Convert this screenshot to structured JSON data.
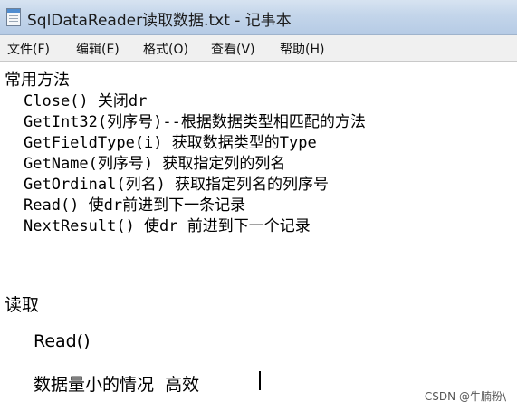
{
  "window": {
    "title": "SqlDataReader读取数据.txt - 记事本"
  },
  "menu": {
    "file": "文件(F)",
    "edit": "编辑(E)",
    "format": "格式(O)",
    "view": "查看(V)",
    "help": "帮助(H)"
  },
  "content": {
    "line1": "常用方法",
    "line2": "Close() 关闭dr",
    "line3": "GetInt32(列序号)--根据数据类型相匹配的方法",
    "line4": "GetFieldType(i) 获取数据类型的Type",
    "line5": "GetName(列序号) 获取指定列的列名",
    "line6": "GetOrdinal(列名) 获取指定列名的列序号",
    "line7": "Read() 使dr前进到下一条记录",
    "line8": "NextResult() 使dr 前进到下一个记录",
    "line9": "读取",
    "line10": "Read()",
    "line11": "数据量小的情况  高效"
  },
  "watermark": "CSDN @牛腩粉\\"
}
